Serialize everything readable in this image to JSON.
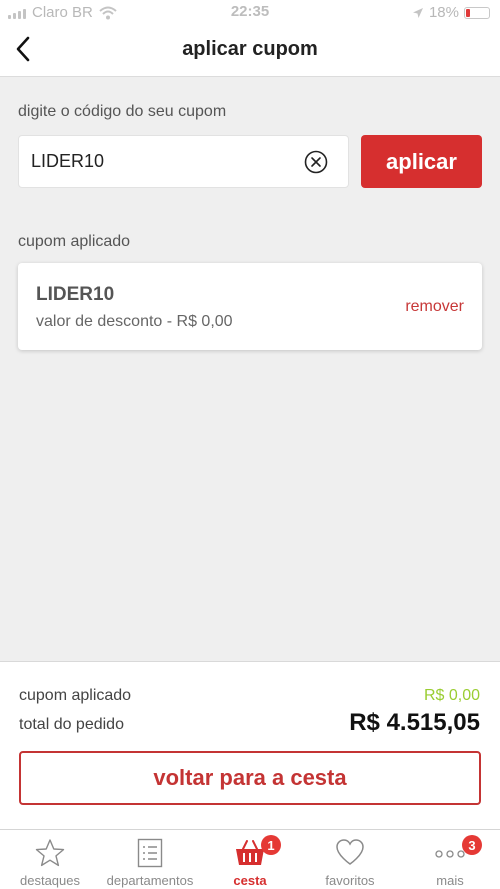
{
  "status_bar": {
    "carrier": "Claro BR",
    "time": "22:35",
    "battery": "18%"
  },
  "header": {
    "title": "aplicar cupom"
  },
  "coupon_form": {
    "label": "digite o código do seu cupom",
    "input_value": "LIDER10",
    "apply_label": "aplicar"
  },
  "applied": {
    "section_label": "cupom aplicado",
    "code": "LIDER10",
    "discount_text": "valor de desconto - R$ 0,00",
    "remove_label": "remover"
  },
  "summary": {
    "coupon_label": "cupom aplicado",
    "coupon_value": "R$ 0,00",
    "total_label": "total do pedido",
    "total_value": "R$ 4.515,05",
    "back_button": "voltar para a cesta"
  },
  "tabs": [
    {
      "label": "destaques",
      "icon": "star-icon"
    },
    {
      "label": "departamentos",
      "icon": "list-icon"
    },
    {
      "label": "cesta",
      "icon": "basket-icon",
      "badge": "1",
      "active": true
    },
    {
      "label": "favoritos",
      "icon": "heart-icon"
    },
    {
      "label": "mais",
      "icon": "more-icon",
      "badge": "3"
    }
  ],
  "colors": {
    "accent": "#d62f2f",
    "discount_green": "#9acd32"
  }
}
